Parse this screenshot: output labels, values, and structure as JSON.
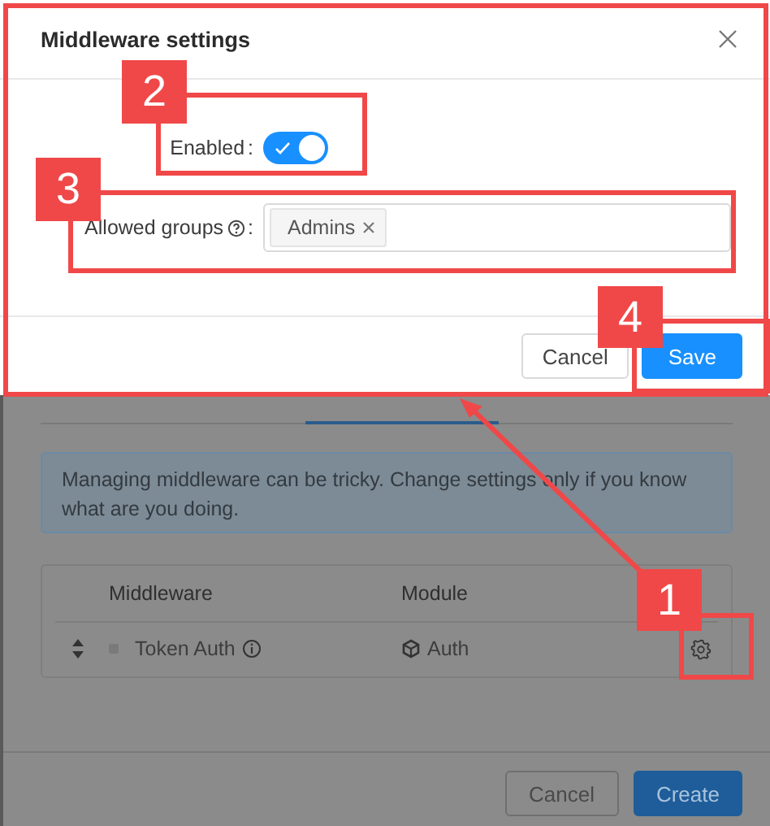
{
  "page": {
    "alert": "Managing middleware can be tricky. Change settings only if you know what are you doing.",
    "table": {
      "columns": [
        "Middleware",
        "Module"
      ],
      "rows": [
        {
          "name": "Token Auth",
          "module": "Auth"
        }
      ]
    },
    "buttons": [
      {
        "label": "Cancel",
        "primary": false
      },
      {
        "label": "Create",
        "primary": true
      }
    ]
  },
  "modal": {
    "title": "Middleware settings",
    "fields": [
      {
        "kind": "switch",
        "label": "Enabled",
        "colon": ":",
        "on": true
      },
      {
        "kind": "tags",
        "label": "Allowed groups",
        "colon": ":",
        "help": true,
        "tags": [
          "Admins"
        ]
      }
    ],
    "buttons": [
      {
        "label": "Cancel",
        "primary": false
      },
      {
        "label": "Save",
        "primary": true
      }
    ]
  },
  "annotations": [
    {
      "number": "1"
    },
    {
      "number": "2"
    },
    {
      "number": "3"
    },
    {
      "number": "4"
    }
  ]
}
